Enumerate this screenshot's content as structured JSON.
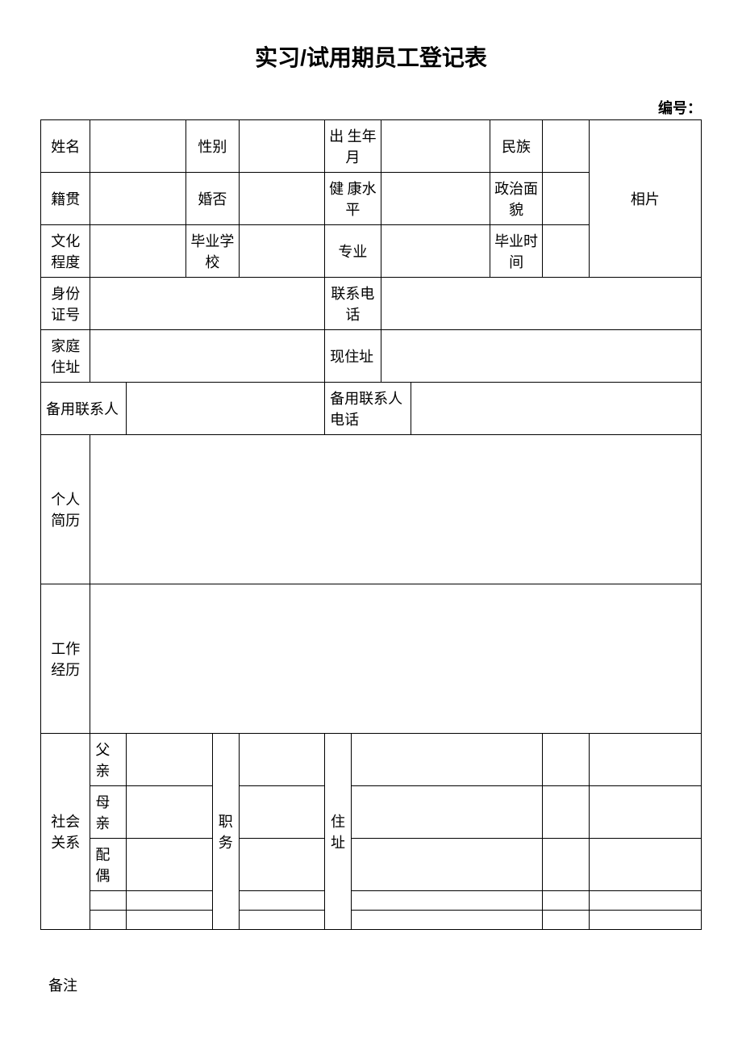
{
  "title": "实习/试用期员工登记表",
  "docNoLabel": "编号：",
  "labels": {
    "name": "姓名",
    "gender": "性别",
    "birth": "出 生年月",
    "ethnic": "民族",
    "photo": "相片",
    "native": "籍贯",
    "married": "婚否",
    "health": "健 康水平",
    "political": "政治面貌",
    "education": "文化程度",
    "school": "毕业学校",
    "major": "专业",
    "gradTime": "毕业时间",
    "idNo": "身份证号",
    "phone": "联系电话",
    "homeAddr": "家庭住址",
    "currAddr": "现住址",
    "backupContact": "备用联系人",
    "backupPhone": "备用联系人电话",
    "resume": "个人简历",
    "workExp": "工作经历",
    "social": "社会关系",
    "father": "父亲",
    "mother": "母亲",
    "spouse": "配偶",
    "position": "职务",
    "address": "住址",
    "remarks": "备注"
  },
  "values": {
    "name": "",
    "gender": "",
    "birth": "",
    "ethnic": "",
    "native": "",
    "married": "",
    "health": "",
    "political": "",
    "education": "",
    "school": "",
    "major": "",
    "gradTime": "",
    "idNo": "",
    "phone": "",
    "homeAddr": "",
    "currAddr": "",
    "backupContact": "",
    "backupPhone": "",
    "resume": "",
    "workExp": "",
    "fatherName": "",
    "motherName": "",
    "spouseName": "",
    "rel4Name": "",
    "rel5Name": "",
    "fatherPos": "",
    "motherPos": "",
    "spousePos": "",
    "rel4Pos": "",
    "rel5Pos": "",
    "fatherAddr": "",
    "motherAddr": "",
    "spouseAddr": "",
    "rel4Addr": "",
    "rel5Addr": "",
    "fatherExtra": "",
    "motherExtra": "",
    "spouseExtra": "",
    "rel4Extra": "",
    "rel5Extra": ""
  }
}
